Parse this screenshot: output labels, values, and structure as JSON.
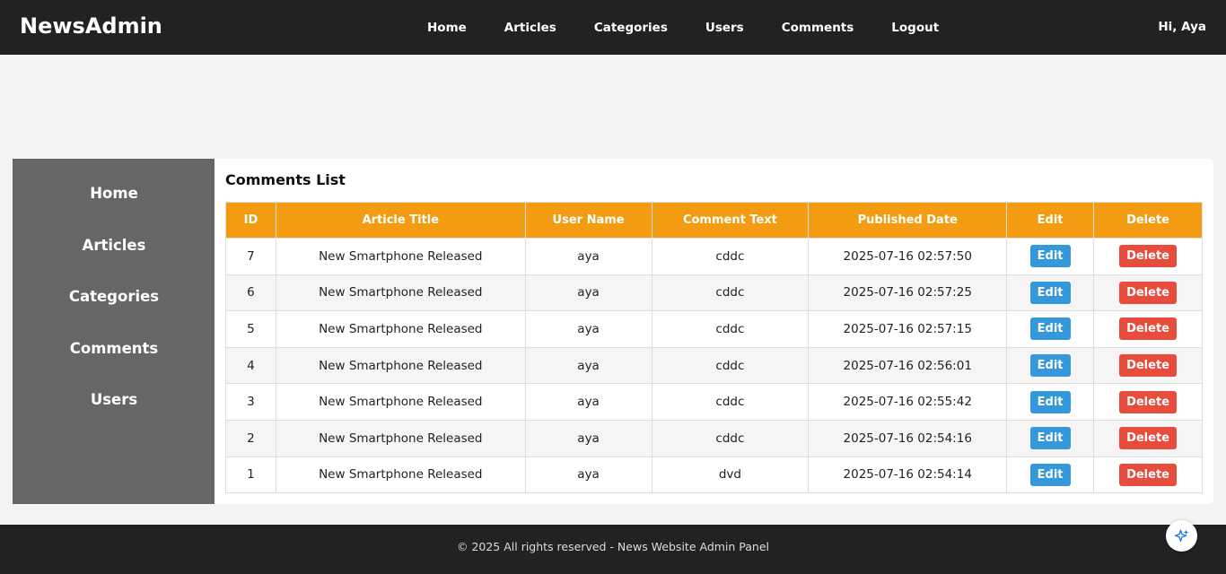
{
  "header": {
    "brand": "NewsAdmin",
    "nav": [
      "Home",
      "Articles",
      "Categories",
      "Users",
      "Comments",
      "Logout"
    ],
    "greeting": "Hi, Aya"
  },
  "sidebar": {
    "items": [
      "Home",
      "Articles",
      "Categories",
      "Comments",
      "Users"
    ]
  },
  "main": {
    "title": "Comments List",
    "columns": [
      "ID",
      "Article Title",
      "User Name",
      "Comment Text",
      "Published Date",
      "Edit",
      "Delete"
    ],
    "rows": [
      {
        "id": "7",
        "article": "New Smartphone Released",
        "user": "aya",
        "text": "cddc",
        "date": "2025-07-16 02:57:50"
      },
      {
        "id": "6",
        "article": "New Smartphone Released",
        "user": "aya",
        "text": "cddc",
        "date": "2025-07-16 02:57:25"
      },
      {
        "id": "5",
        "article": "New Smartphone Released",
        "user": "aya",
        "text": "cddc",
        "date": "2025-07-16 02:57:15"
      },
      {
        "id": "4",
        "article": "New Smartphone Released",
        "user": "aya",
        "text": "cddc",
        "date": "2025-07-16 02:56:01"
      },
      {
        "id": "3",
        "article": "New Smartphone Released",
        "user": "aya",
        "text": "cddc",
        "date": "2025-07-16 02:55:42"
      },
      {
        "id": "2",
        "article": "New Smartphone Released",
        "user": "aya",
        "text": "cddc",
        "date": "2025-07-16 02:54:16"
      },
      {
        "id": "1",
        "article": "New Smartphone Released",
        "user": "aya",
        "text": "dvd",
        "date": "2025-07-16 02:54:14"
      }
    ],
    "edit_label": "Edit",
    "delete_label": "Delete"
  },
  "footer": {
    "text": "© 2025 All rights reserved - News Website Admin Panel"
  },
  "colors": {
    "header_bg": "#222222",
    "sidebar_bg": "#666666",
    "table_header": "#f39c12",
    "edit_button": "#3498db",
    "delete_button": "#e74c3c"
  },
  "icons": {
    "assistant": "sparkle-icon"
  }
}
